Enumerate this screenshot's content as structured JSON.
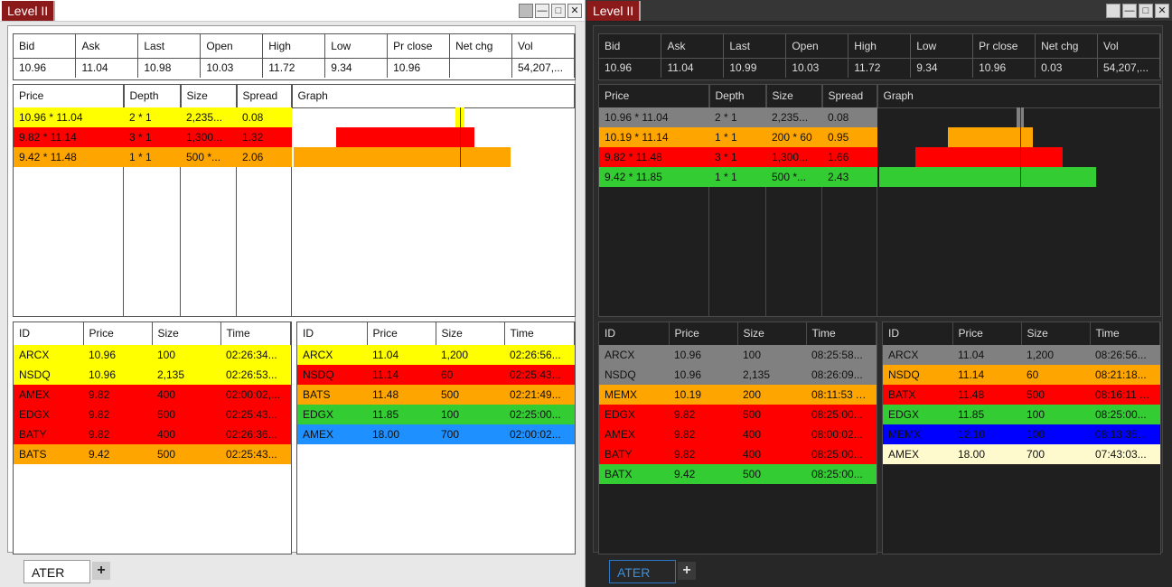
{
  "light": {
    "title": "Level II",
    "tab": "ATER",
    "add_tab": "+",
    "quote": {
      "headers": [
        "Bid",
        "Ask",
        "Last",
        "Open",
        "High",
        "Low",
        "Pr close",
        "Net chg",
        "Vol"
      ],
      "values": [
        "10.96",
        "11.04",
        "10.98",
        "10.03",
        "11.72",
        "9.34",
        "10.96",
        "",
        "54,207,..."
      ]
    },
    "book": {
      "headers": [
        "Price",
        "Depth",
        "Size",
        "Spread",
        "Graph"
      ],
      "rows": [
        {
          "price": "10.96 * 11.04",
          "depth": "2 * 1",
          "size": "2,235...",
          "spread": "0.08",
          "color": "#ffff00"
        },
        {
          "price": "9.82 * 11.14",
          "depth": "3 * 1",
          "size": "1,300...",
          "spread": "1.32",
          "color": "#ff0000"
        },
        {
          "price": "9.42 * 11.48",
          "depth": "1 * 1",
          "size": "500 *...",
          "spread": "2.06",
          "color": "#ffa500"
        }
      ]
    },
    "bids": {
      "headers": [
        "ID",
        "Price",
        "Size",
        "Time"
      ],
      "rows": [
        {
          "id": "ARCX",
          "price": "10.96",
          "size": "100",
          "time": "02:26:34...",
          "color": "#ffff00"
        },
        {
          "id": "NSDQ",
          "price": "10.96",
          "size": "2,135",
          "time": "02:26:53...",
          "color": "#ffff00"
        },
        {
          "id": "AMEX",
          "price": "9.82",
          "size": "400",
          "time": "02:00:02,...",
          "color": "#ff0000"
        },
        {
          "id": "EDGX",
          "price": "9.82",
          "size": "500",
          "time": "02:25:43...",
          "color": "#ff0000"
        },
        {
          "id": "BATY",
          "price": "9.82",
          "size": "400",
          "time": "02:26:36...",
          "color": "#ff0000"
        },
        {
          "id": "BATS",
          "price": "9.42",
          "size": "500",
          "time": "02:25:43...",
          "color": "#ffa500"
        }
      ]
    },
    "asks": {
      "headers": [
        "ID",
        "Price",
        "Size",
        "Time"
      ],
      "rows": [
        {
          "id": "ARCX",
          "price": "11.04",
          "size": "1,200",
          "time": "02:26:56...",
          "color": "#ffff00"
        },
        {
          "id": "NSDQ",
          "price": "11.14",
          "size": "60",
          "time": "02:25:43...",
          "color": "#ff0000"
        },
        {
          "id": "BATS",
          "price": "11.48",
          "size": "500",
          "time": "02:21:49...",
          "color": "#ffa500"
        },
        {
          "id": "EDGX",
          "price": "11.85",
          "size": "100",
          "time": "02:25:00...",
          "color": "#33cc33"
        },
        {
          "id": "AMEX",
          "price": "18.00",
          "size": "700",
          "time": "02:00:02...",
          "color": "#1e90ff"
        }
      ]
    }
  },
  "dark": {
    "title": "Level II",
    "tab": "ATER",
    "add_tab": "+",
    "quote": {
      "headers": [
        "Bid",
        "Ask",
        "Last",
        "Open",
        "High",
        "Low",
        "Pr close",
        "Net chg",
        "Vol"
      ],
      "values": [
        "10.96",
        "11.04",
        "10.99",
        "10.03",
        "11.72",
        "9.34",
        "10.96",
        "0.03",
        "54,207,..."
      ]
    },
    "book": {
      "headers": [
        "Price",
        "Depth",
        "Size",
        "Spread",
        "Graph"
      ],
      "rows": [
        {
          "price": "10.96 * 11.04",
          "depth": "2 * 1",
          "size": "2,235...",
          "spread": "0.08",
          "color": "#808080"
        },
        {
          "price": "10.19 * 11.14",
          "depth": "1 * 1",
          "size": "200 * 60",
          "spread": "0.95",
          "color": "#ffa500"
        },
        {
          "price": "9.82 * 11.48",
          "depth": "3 * 1",
          "size": "1,300...",
          "spread": "1.66",
          "color": "#ff0000"
        },
        {
          "price": "9.42 * 11.85",
          "depth": "1 * 1",
          "size": "500 *...",
          "spread": "2.43",
          "color": "#33cc33"
        }
      ]
    },
    "bids": {
      "headers": [
        "ID",
        "Price",
        "Size",
        "Time"
      ],
      "rows": [
        {
          "id": "ARCX",
          "price": "10.96",
          "size": "100",
          "time": "08:25:58...",
          "color": "#808080"
        },
        {
          "id": "NSDQ",
          "price": "10.96",
          "size": "2,135",
          "time": "08:26:09...",
          "color": "#808080"
        },
        {
          "id": "MEMX",
          "price": "10.19",
          "size": "200",
          "time": "08:11:53 AM",
          "color": "#ffa500"
        },
        {
          "id": "EDGX",
          "price": "9.82",
          "size": "500",
          "time": "08:25:00...",
          "color": "#ff0000"
        },
        {
          "id": "AMEX",
          "price": "9.82",
          "size": "400",
          "time": "08:00:02...",
          "color": "#ff0000"
        },
        {
          "id": "BATY",
          "price": "9.82",
          "size": "400",
          "time": "08:25:00...",
          "color": "#ff0000"
        },
        {
          "id": "BATX",
          "price": "9.42",
          "size": "500",
          "time": "08:25:00...",
          "color": "#33cc33"
        }
      ]
    },
    "asks": {
      "headers": [
        "ID",
        "Price",
        "Size",
        "Time"
      ],
      "rows": [
        {
          "id": "ARCX",
          "price": "11.04",
          "size": "1,200",
          "time": "08:26:56...",
          "color": "#808080"
        },
        {
          "id": "NSDQ",
          "price": "11.14",
          "size": "60",
          "time": "08:21:18...",
          "color": "#ffa500"
        },
        {
          "id": "BATX",
          "price": "11.48",
          "size": "500",
          "time": "08:16:11 AM",
          "color": "#ff0000"
        },
        {
          "id": "EDGX",
          "price": "11.85",
          "size": "100",
          "time": "08:25:00...",
          "color": "#33cc33"
        },
        {
          "id": "MEMX",
          "price": "12.10",
          "size": "100",
          "time": "08:13:35...",
          "color": "#0000ff"
        },
        {
          "id": "AMEX",
          "price": "18.00",
          "size": "700",
          "time": "07:43:03...",
          "color": "#fffacd"
        }
      ]
    }
  }
}
